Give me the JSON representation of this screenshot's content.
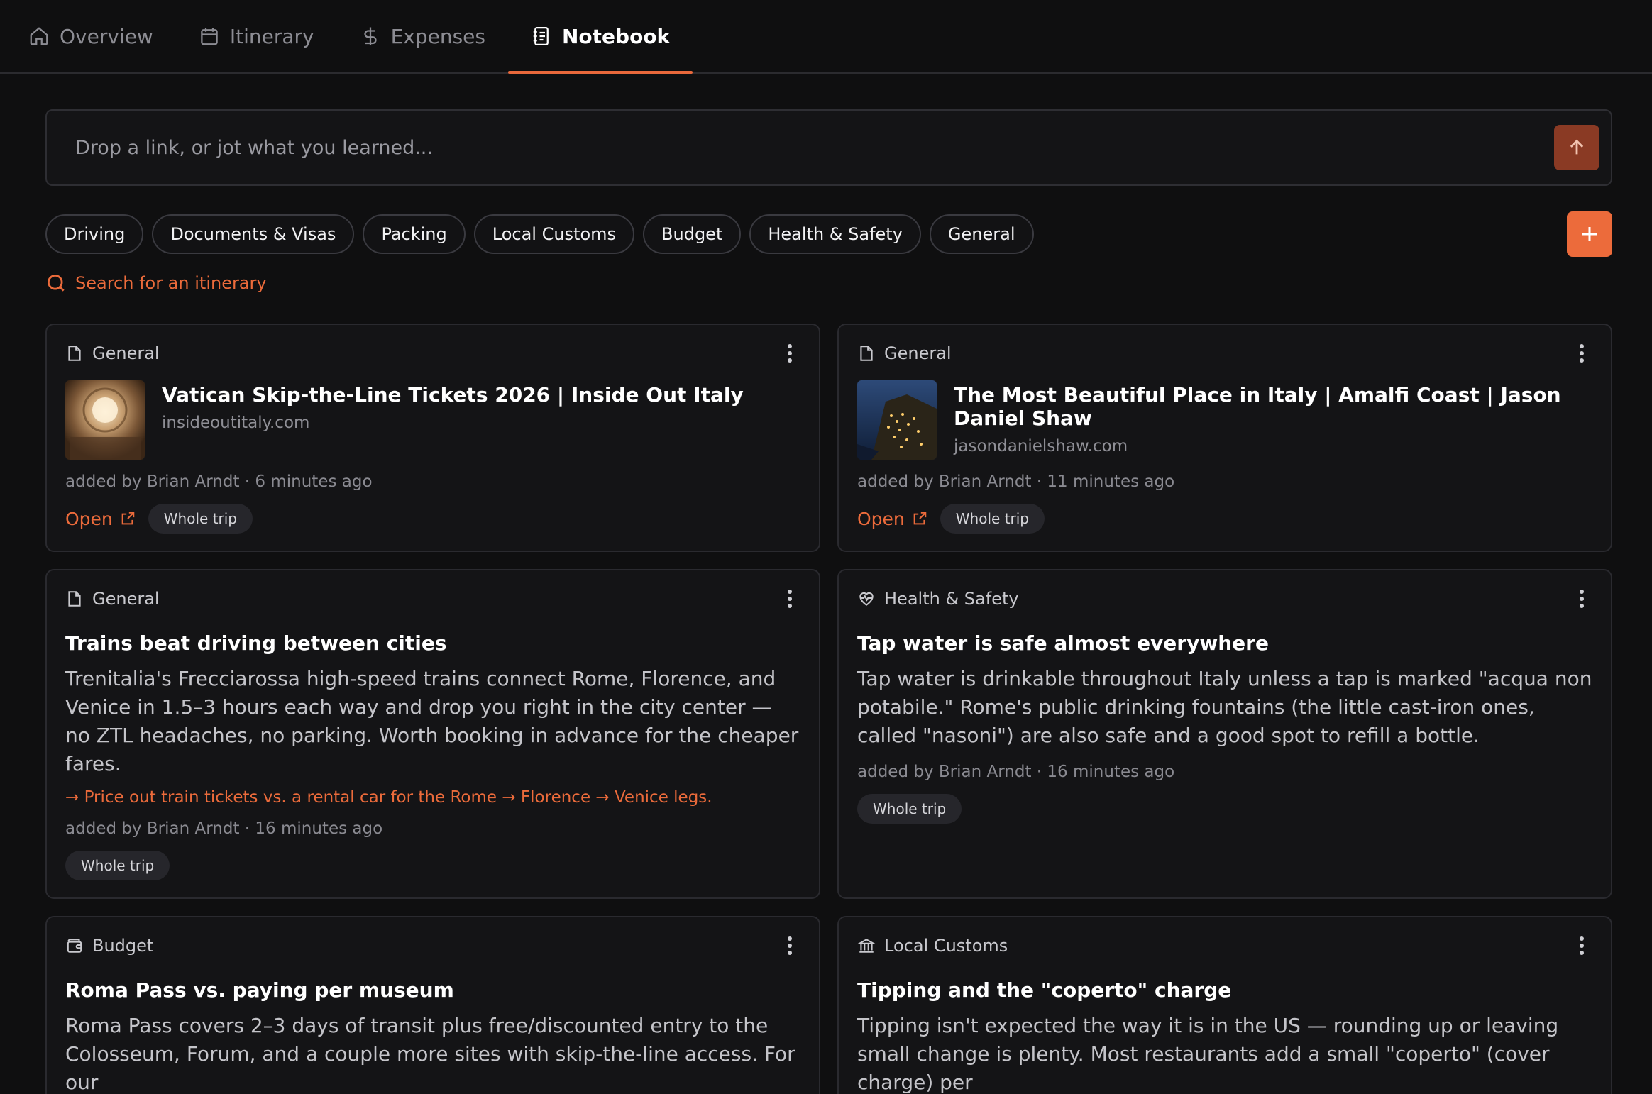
{
  "nav": {
    "tabs": [
      {
        "label": "Overview",
        "icon": "home-icon"
      },
      {
        "label": "Itinerary",
        "icon": "calendar-icon"
      },
      {
        "label": "Expenses",
        "icon": "dollar-icon"
      },
      {
        "label": "Notebook",
        "icon": "notebook-icon",
        "active": true
      }
    ]
  },
  "composer": {
    "placeholder": "Drop a link, or jot what you learned..."
  },
  "chips": [
    "Driving",
    "Documents & Visas",
    "Packing",
    "Local Customs",
    "Budget",
    "Health & Safety",
    "General"
  ],
  "search": {
    "label": "Search for an itinerary"
  },
  "colors": {
    "accent": "#ec6b3b",
    "background": "#0f0f10",
    "card": "#141416"
  },
  "cards": [
    {
      "category": "General",
      "title": "Vatican Skip-the-Line Tickets 2026 | Inside Out Italy",
      "domain": "insideoutitaly.com",
      "meta": "added by Brian Arndt · 6 minutes ago",
      "open_label": "Open",
      "tag": "Whole trip"
    },
    {
      "category": "General",
      "title": "The Most Beautiful Place in Italy | Amalfi Coast | Jason Daniel Shaw",
      "domain": "jasondanielshaw.com",
      "meta": "added by Brian Arndt · 11 minutes ago",
      "open_label": "Open",
      "tag": "Whole trip"
    },
    {
      "category": "General",
      "title": "Trains beat driving between cities",
      "text": "Trenitalia's Frecciarossa high-speed trains connect Rome, Florence, and Venice in 1.5–3 hours each way and drop you right in the city center — no ZTL headaches, no parking. Worth booking in advance for the cheaper fares.",
      "action": "→ Price out train tickets vs. a rental car for the Rome → Florence → Venice legs.",
      "meta": "added by Brian Arndt · 16 minutes ago",
      "tag": "Whole trip"
    },
    {
      "category": "Health & Safety",
      "title": "Tap water is safe almost everywhere",
      "text": "Tap water is drinkable throughout Italy unless a tap is marked \"acqua non potabile.\" Rome's public drinking fountains (the little cast-iron ones, called \"nasoni\") are also safe and a good spot to refill a bottle.",
      "meta": "added by Brian Arndt · 16 minutes ago",
      "tag": "Whole trip"
    },
    {
      "category": "Budget",
      "title": "Roma Pass vs. paying per museum",
      "text": "Roma Pass covers 2–3 days of transit plus free/discounted entry to the Colosseum, Forum, and a couple more sites with skip-the-line access. For our"
    },
    {
      "category": "Local Customs",
      "title": "Tipping and the \"coperto\" charge",
      "text": "Tipping isn't expected the way it is in the US — rounding up or leaving small change is plenty. Most restaurants add a small \"coperto\" (cover charge) per"
    }
  ]
}
